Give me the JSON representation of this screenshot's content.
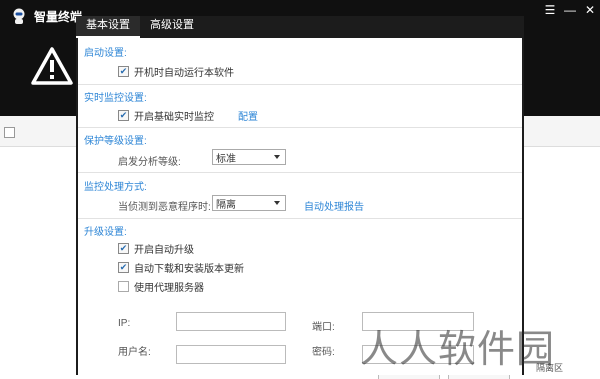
{
  "app": {
    "title": "智量终端"
  },
  "window_controls": {
    "menu": "☰",
    "minimize": "—",
    "close": "✕"
  },
  "background": {
    "bottom_right_label": "隔离区"
  },
  "tabs": [
    {
      "label": "基本设置",
      "active": true
    },
    {
      "label": "高级设置",
      "active": false
    }
  ],
  "startup": {
    "title": "启动设置:",
    "autostart_label": "开机时自动运行本软件",
    "autostart_checked": true
  },
  "realtime": {
    "title": "实时监控设置:",
    "enable_label": "开启基础实时监控",
    "enable_checked": true,
    "config_link": "配置"
  },
  "protection": {
    "title": "保护等级设置:",
    "level_label": "启发分析等级:",
    "level_value": "标准"
  },
  "monitor_action": {
    "title": "监控处理方式:",
    "detect_label": "当侦测到恶意程序时:",
    "action_value": "隔离",
    "report_link": "自动处理报告"
  },
  "upgrade": {
    "title": "升级设置:",
    "auto_upgrade_label": "开启自动升级",
    "auto_upgrade_checked": true,
    "auto_download_label": "自动下载和安装版本更新",
    "auto_download_checked": true,
    "proxy_label": "使用代理服务器",
    "proxy_checked": false,
    "ip_label": "IP:",
    "port_label": "端口:",
    "username_label": "用户名:",
    "password_label": "密码:",
    "ip_value": "",
    "port_value": "",
    "username_value": "",
    "password_value": ""
  },
  "watermark": "人人软件园",
  "colors": {
    "section_title": "#2e86d6",
    "link": "#2e86d6",
    "header_bg": "#101010"
  },
  "icons": {
    "logo": "robot-logo-icon",
    "warning": "warning-triangle-icon"
  }
}
